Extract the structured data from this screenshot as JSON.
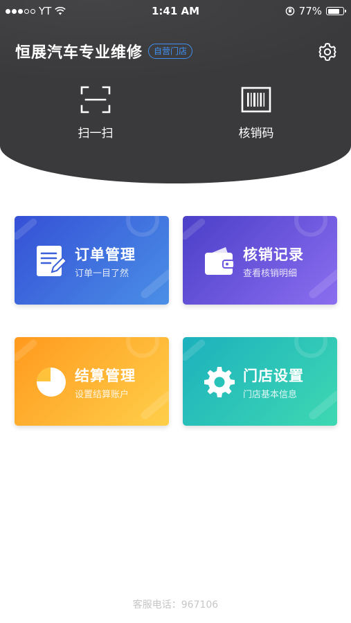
{
  "status_bar": {
    "carrier": "YT",
    "time": "1:41 AM",
    "battery": "77%",
    "signal_bars_filled": 3,
    "signal_bars_total": 5
  },
  "header": {
    "store_name": "恒展汽车专业维修",
    "store_badge": "自营门店",
    "settings_icon": "gear-icon",
    "background_color": "#3a3a3c",
    "badge_color": "#3d8ff5"
  },
  "quick_actions": [
    {
      "label": "扫一扫",
      "icon": "scan-frame-icon"
    },
    {
      "label": "核销码",
      "icon": "barcode-icon"
    }
  ],
  "cards": [
    {
      "title": "订单管理",
      "subtitle": "订单一目了然",
      "icon": "notepad-icon",
      "gradient": [
        "#3550d6",
        "#4a8fe6"
      ]
    },
    {
      "title": "核销记录",
      "subtitle": "查看核销明细",
      "icon": "wallet-icon",
      "gradient": [
        "#4b3fc8",
        "#8b6ef0"
      ]
    },
    {
      "title": "结算管理",
      "subtitle": "设置结算账户",
      "icon": "pie-chart-icon",
      "gradient": [
        "#ff9a1e",
        "#ffcf4a"
      ]
    },
    {
      "title": "门店设置",
      "subtitle": "门店基本信息",
      "icon": "gear-icon",
      "gradient": [
        "#1cb1bd",
        "#3ed8b2"
      ]
    }
  ],
  "footer": {
    "service_phone": "客服电话：967106"
  }
}
